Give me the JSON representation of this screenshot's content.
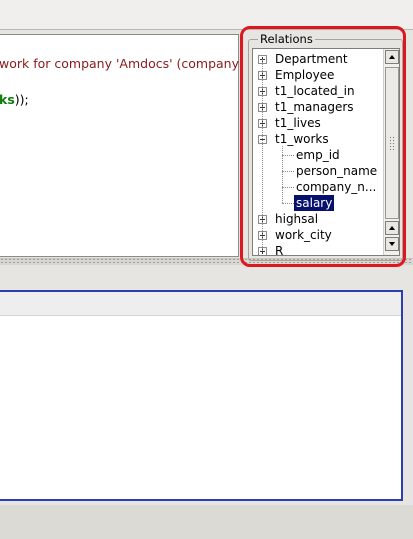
{
  "editor": {
    "line1": "work for company 'Amdocs' (company",
    "line2_bold": "ks",
    "line2_tail": "));"
  },
  "relations": {
    "legend": "Relations",
    "tree": [
      {
        "label": "Department",
        "expanded": false,
        "level": 0
      },
      {
        "label": "Employee",
        "expanded": false,
        "level": 0
      },
      {
        "label": "t1_located_in",
        "expanded": false,
        "level": 0
      },
      {
        "label": "t1_managers",
        "expanded": false,
        "level": 0
      },
      {
        "label": "t1_lives",
        "expanded": false,
        "level": 0
      },
      {
        "label": "t1_works",
        "expanded": true,
        "level": 0
      },
      {
        "label": "emp_id",
        "level": 1
      },
      {
        "label": "person_name",
        "level": 1
      },
      {
        "label": "company_n...",
        "level": 1
      },
      {
        "label": "salary",
        "level": 1,
        "selected": true
      },
      {
        "label": "highsal",
        "expanded": false,
        "level": 0
      },
      {
        "label": "work_city",
        "expanded": false,
        "level": 0
      },
      {
        "label": "R",
        "expanded": false,
        "level": 0
      }
    ]
  },
  "colors": {
    "highlight": "#e0161e",
    "selection": "#07106c",
    "results_border": "#2c3fae"
  }
}
